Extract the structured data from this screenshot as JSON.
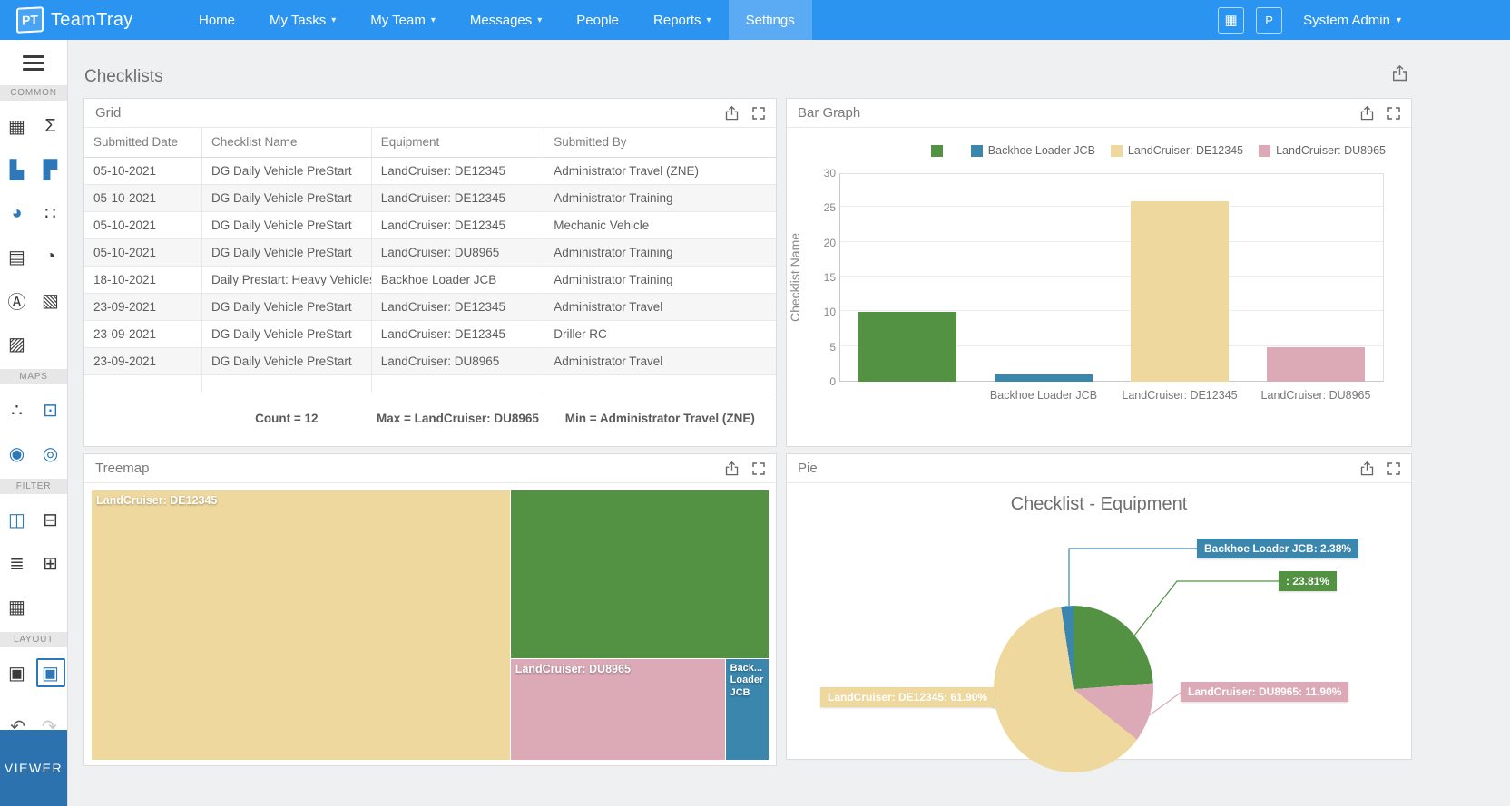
{
  "nav": {
    "logo": "PT",
    "brand": "TeamTray",
    "items": [
      {
        "label": "Home"
      },
      {
        "label": "My Tasks",
        "caret": true
      },
      {
        "label": "My Team",
        "caret": true
      },
      {
        "label": "Messages",
        "caret": true
      },
      {
        "label": "People"
      },
      {
        "label": "Reports",
        "caret": true
      },
      {
        "label": "Settings",
        "active": true
      }
    ],
    "apps_icon": "▦",
    "profile_initial": "P",
    "user": "System Admin"
  },
  "sidebar": {
    "sections": [
      {
        "label": "COMMON",
        "icons": [
          {
            "name": "grid-widget",
            "glyph": "▦",
            "color": "#3c3c3c"
          },
          {
            "name": "sum-widget",
            "glyph": "Σ",
            "color": "#3c3c3c"
          },
          {
            "name": "bar-chart-widget",
            "glyph": "▙",
            "color": "#2e78b8"
          },
          {
            "name": "treemap-widget",
            "glyph": "▛",
            "color": "#2e78b8"
          },
          {
            "name": "pie-chart-widget",
            "glyph": "◕",
            "color": "#2e78b8"
          },
          {
            "name": "scatter-widget",
            "glyph": "∷",
            "color": "#3c3c3c"
          },
          {
            "name": "card-widget",
            "glyph": "▤",
            "color": "#3c3c3c"
          },
          {
            "name": "gauge-widget",
            "glyph": "◔",
            "color": "#3c3c3c"
          },
          {
            "name": "text-widget",
            "glyph": "Ⓐ",
            "color": "#3c3c3c"
          },
          {
            "name": "image-widget",
            "glyph": "▧",
            "color": "#3c3c3c"
          },
          {
            "name": "image-export-widget",
            "glyph": "▨",
            "color": "#3c3c3c"
          }
        ]
      },
      {
        "label": "MAPS",
        "icons": [
          {
            "name": "dot-map-widget",
            "glyph": "∴",
            "color": "#3c3c3c"
          },
          {
            "name": "shape-map-widget",
            "glyph": "⊡",
            "color": "#2e78b8"
          },
          {
            "name": "bubble-map-widget",
            "glyph": "◉",
            "color": "#2e78b8"
          },
          {
            "name": "cluster-map-widget",
            "glyph": "◎",
            "color": "#2e78b8"
          }
        ]
      },
      {
        "label": "FILTER",
        "icons": [
          {
            "name": "range-filter-widget",
            "glyph": "◫",
            "color": "#2e78b8"
          },
          {
            "name": "combo-filter-widget",
            "glyph": "⊟",
            "color": "#3c3c3c"
          },
          {
            "name": "list-filter-widget",
            "glyph": "≣",
            "color": "#3c3c3c"
          },
          {
            "name": "popup-filter-widget",
            "glyph": "⊞",
            "color": "#3c3c3c"
          },
          {
            "name": "date-filter-widget",
            "glyph": "▦",
            "color": "#3c3c3c"
          }
        ]
      },
      {
        "label": "LAYOUT",
        "icons": [
          {
            "name": "tab-layout-widget",
            "glyph": "▣",
            "color": "#3c3c3c"
          },
          {
            "name": "group-layout-widget",
            "glyph": "▣",
            "color": "#2e78b8",
            "selected": true
          }
        ]
      }
    ],
    "tools": [
      {
        "name": "undo-button",
        "glyph": "↶",
        "color": "#5c5c5c"
      },
      {
        "name": "redo-button",
        "glyph": "↷",
        "color": "#c8c8c8"
      }
    ],
    "viewer_label": "VIEWER"
  },
  "page": {
    "title": "Checklists"
  },
  "panels": {
    "grid": {
      "title": "Grid"
    },
    "bar": {
      "title": "Bar Graph"
    },
    "treemap": {
      "title": "Treemap"
    },
    "pie": {
      "title": "Pie"
    }
  },
  "grid_panel": {
    "columns": [
      "Submitted Date",
      "Checklist Name",
      "Equipment",
      "Submitted By"
    ],
    "rows": [
      [
        "05-10-2021",
        "DG Daily Vehicle PreStart",
        "LandCruiser: DE12345",
        "Administrator Travel (ZNE)"
      ],
      [
        "05-10-2021",
        "DG Daily Vehicle PreStart",
        "LandCruiser: DE12345",
        "Administrator Training"
      ],
      [
        "05-10-2021",
        "DG Daily Vehicle PreStart",
        "LandCruiser: DE12345",
        "Mechanic Vehicle"
      ],
      [
        "05-10-2021",
        "DG Daily Vehicle PreStart",
        "LandCruiser: DU8965",
        "Administrator Training"
      ],
      [
        "18-10-2021",
        "Daily Prestart: Heavy Vehicles",
        "Backhoe Loader JCB",
        "Administrator Training"
      ],
      [
        "23-09-2021",
        "DG Daily Vehicle PreStart",
        "LandCruiser: DE12345",
        "Administrator Travel"
      ],
      [
        "23-09-2021",
        "DG Daily Vehicle PreStart",
        "LandCruiser: DE12345",
        "Driller RC"
      ],
      [
        "23-09-2021",
        "DG Daily Vehicle PreStart",
        "LandCruiser: DU8965",
        "Administrator Travel"
      ]
    ],
    "summary": {
      "count": "Count = 12",
      "max": "Max = LandCruiser: DU8965",
      "min": "Min = Administrator Travel (ZNE)"
    }
  },
  "palette": {
    "green": "#549243",
    "blue": "#3a86ad",
    "tan": "#eed89d",
    "pink": "#dbaab6",
    "nav_blue": "#2a94f0",
    "viewer_blue": "#2b72ae"
  },
  "chart_data": [
    {
      "id": "bar",
      "type": "bar",
      "categories": [
        "",
        "Backhoe Loader JCB",
        "LandCruiser: DE12345",
        "LandCruiser: DU8965"
      ],
      "values": [
        10,
        1,
        26,
        5
      ],
      "colors": [
        "#549243",
        "#3a86ad",
        "#eed89d",
        "#dbaab6"
      ],
      "ylabel": "Checklist Name",
      "ylim": [
        0,
        30
      ],
      "ytick_step": 5,
      "grid": true,
      "legend_position": "top",
      "legend": [
        {
          "label": "",
          "color": "#549243"
        },
        {
          "label": "Backhoe Loader JCB",
          "color": "#3a86ad"
        },
        {
          "label": "LandCruiser: DE12345",
          "color": "#eed89d"
        },
        {
          "label": "LandCruiser: DU8965",
          "color": "#dbaab6"
        }
      ]
    },
    {
      "id": "treemap",
      "type": "treemap",
      "items": [
        {
          "label": "LandCruiser: DE12345",
          "value": 61.9,
          "color": "#eed89d"
        },
        {
          "label": "",
          "value": 23.81,
          "color": "#549243"
        },
        {
          "label": "LandCruiser: DU8965",
          "value": 11.9,
          "color": "#dbaab6"
        },
        {
          "label": "Back... Loader JCB",
          "value": 2.38,
          "color": "#3a86ad"
        }
      ]
    },
    {
      "id": "pie",
      "type": "pie",
      "title": "Checklist - Equipment",
      "start_angle_deg": -8.57,
      "slices": [
        {
          "label": "Backhoe Loader JCB",
          "pct": 2.38,
          "color": "#3a86ad",
          "callout": "Backhoe Loader JCB: 2.38%"
        },
        {
          "label": "",
          "pct": 23.81,
          "color": "#549243",
          "callout": ": 23.81%"
        },
        {
          "label": "LandCruiser: DU8965",
          "pct": 11.9,
          "color": "#dbaab6",
          "callout": "LandCruiser: DU8965: 11.90%"
        },
        {
          "label": "LandCruiser: DE12345",
          "pct": 61.9,
          "color": "#eed89d",
          "callout": "LandCruiser: DE12345: 61.90%"
        }
      ]
    }
  ]
}
